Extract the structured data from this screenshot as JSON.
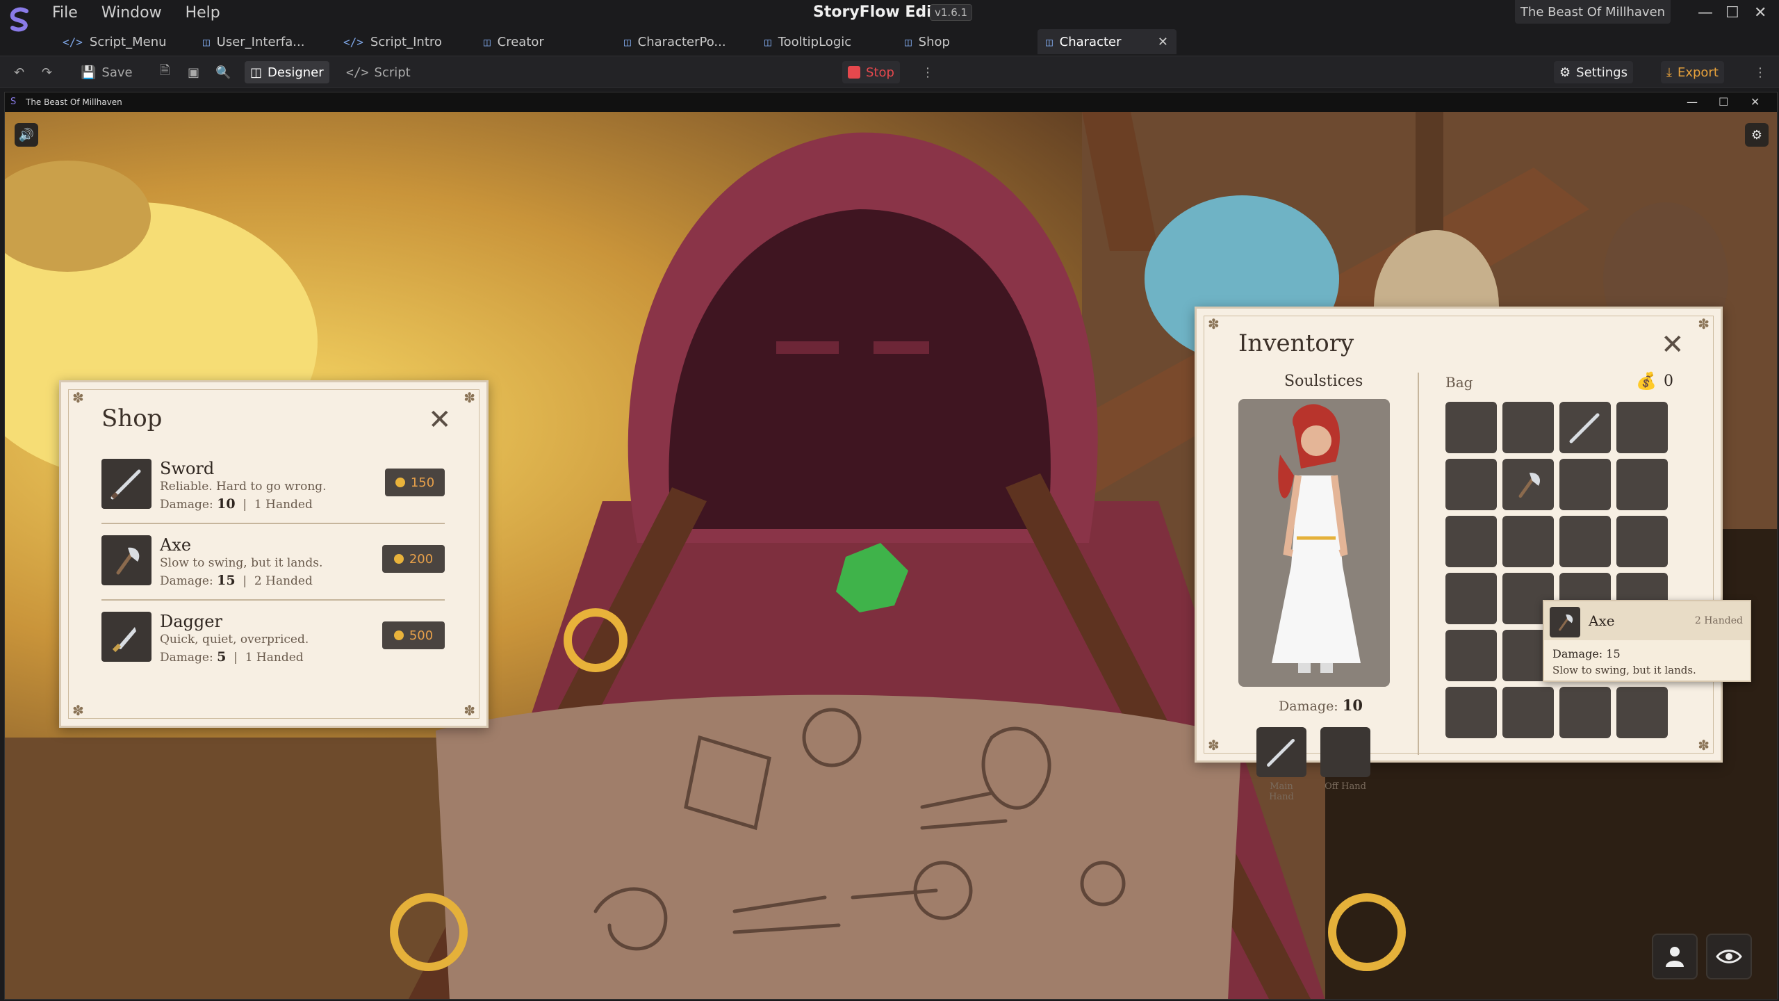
{
  "app": {
    "title": "StoryFlow Editor",
    "version": "v1.6.1",
    "menu": [
      "File",
      "Window",
      "Help"
    ],
    "project": "The Beast Of Millhaven"
  },
  "tabs": [
    {
      "label": "Script_Menu",
      "icon": "code-icon"
    },
    {
      "label": "User_Interfa...",
      "icon": "layout-icon"
    },
    {
      "label": "Script_Intro",
      "icon": "code-icon"
    },
    {
      "label": "Creator",
      "icon": "layout-icon"
    },
    {
      "label": "CharacterPo...",
      "icon": "layout-icon"
    },
    {
      "label": "TooltipLogic",
      "icon": "layout-icon"
    },
    {
      "label": "Shop",
      "icon": "layout-icon"
    },
    {
      "label": "Character",
      "icon": "layout-icon",
      "active": true
    }
  ],
  "toolbar": {
    "save": "Save",
    "designer": "Designer",
    "script": "Script",
    "stop": "Stop",
    "settings": "Settings",
    "export": "Export"
  },
  "game_window": {
    "title": "The Beast Of Millhaven"
  },
  "shop": {
    "title": "Shop",
    "items": [
      {
        "name": "Sword",
        "description": "Reliable. Hard to go wrong.",
        "damage_label": "Damage:",
        "damage": "10",
        "hands": "1 Handed",
        "price": "150"
      },
      {
        "name": "Axe",
        "description": "Slow to swing, but it lands.",
        "damage_label": "Damage:",
        "damage": "15",
        "hands": "2 Handed",
        "price": "200"
      },
      {
        "name": "Dagger",
        "description": "Quick, quiet, overpriced.",
        "damage_label": "Damage:",
        "damage": "5",
        "hands": "1 Handed",
        "price": "500"
      }
    ]
  },
  "inventory": {
    "title": "Inventory",
    "character_name": "Soulstices",
    "bag_label": "Bag",
    "coins": "0",
    "damage_label": "Damage:",
    "damage": "10",
    "main_hand": "Main Hand",
    "off_hand": "Off Hand"
  },
  "tooltip": {
    "name": "Axe",
    "hands": "2 Handed",
    "damage": "Damage: 15",
    "description": "Slow to swing, but it lands."
  },
  "colors": {
    "accent_stop": "#e5484d",
    "accent_export": "#e8a23c",
    "panel_bg": "#f7efe3",
    "slot_bg": "#4a4440",
    "price_text": "#e7a04a"
  }
}
